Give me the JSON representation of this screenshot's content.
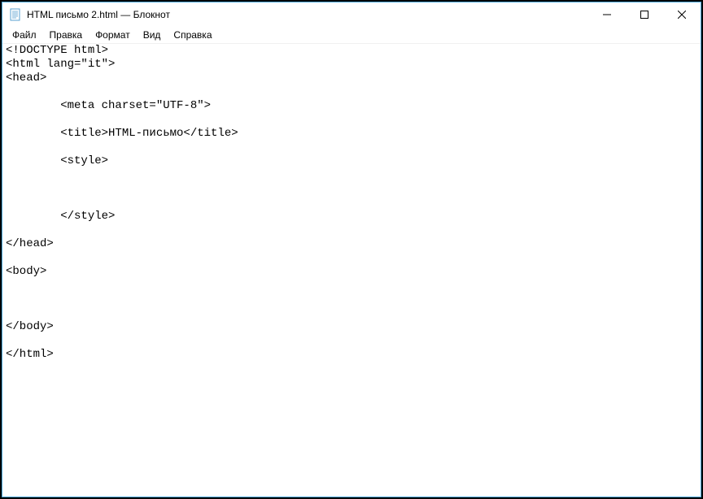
{
  "window": {
    "title": "HTML письмо 2.html — Блокнот"
  },
  "menu": {
    "file": "Файл",
    "edit": "Правка",
    "format": "Формат",
    "view": "Вид",
    "help": "Справка"
  },
  "content": {
    "text": "<!DOCTYPE html>\n<html lang=\"it\">\n<head>\n\n        <meta charset=\"UTF-8\">\n\n        <title>HTML-письмо</title>\n\n        <style>\n\n\n\n        </style>\n\n</head>\n\n<body>\n\n\n\n</body>\n\n</html>"
  }
}
